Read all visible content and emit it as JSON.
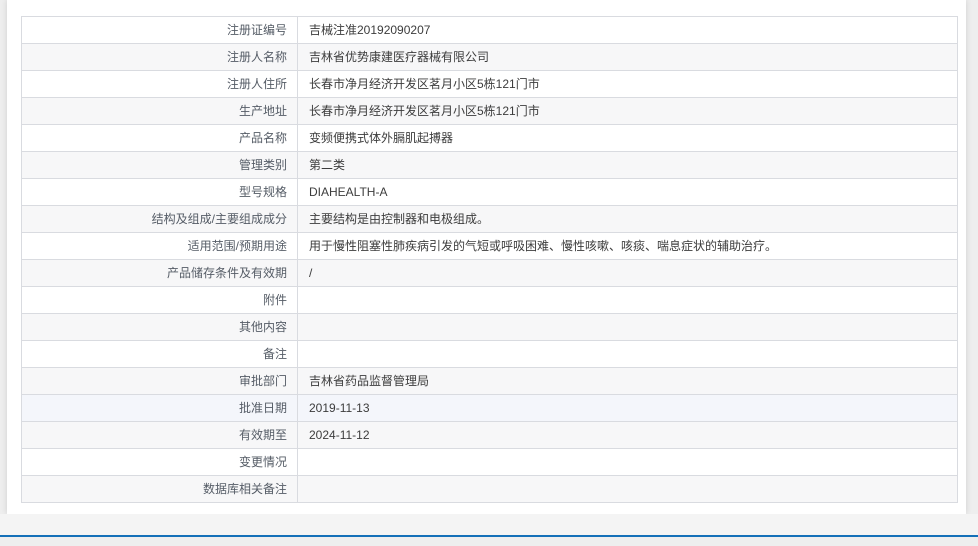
{
  "page": {
    "accent_color": "#1470b8",
    "background_color": "#eeeeee",
    "card_color": "#ffffff",
    "row_alt_color": "#f7f7f8",
    "row_highlight_color": "#f4f6fb"
  },
  "detail_table": {
    "rows": [
      {
        "label": "注册证编号",
        "value": "吉械注准20192090207",
        "style": "row-white"
      },
      {
        "label": "注册人名称",
        "value": "吉林省优势康建医疗器械有限公司",
        "style": "row-gray"
      },
      {
        "label": "注册人住所",
        "value": "长春市净月经济开发区茗月小区5栋121门市",
        "style": "row-white"
      },
      {
        "label": "生产地址",
        "value": "长春市净月经济开发区茗月小区5栋121门市",
        "style": "row-gray"
      },
      {
        "label": "产品名称",
        "value": "变频便携式体外膈肌起搏器",
        "style": "row-white"
      },
      {
        "label": "管理类别",
        "value": "第二类",
        "style": "row-gray"
      },
      {
        "label": "型号规格",
        "value": "DIAHEALTH-A",
        "style": "row-white"
      },
      {
        "label": "结构及组成/主要组成成分",
        "value": "主要结构是由控制器和电极组成。",
        "style": "row-gray"
      },
      {
        "label": "适用范围/预期用途",
        "value": "用于慢性阻塞性肺疾病引发的气短或呼吸困难、慢性咳嗽、咳痰、喘息症状的辅助治疗。",
        "style": "row-white"
      },
      {
        "label": "产品储存条件及有效期",
        "value": "/",
        "style": "row-gray"
      },
      {
        "label": "附件",
        "value": "",
        "style": "row-white"
      },
      {
        "label": "其他内容",
        "value": "",
        "style": "row-gray"
      },
      {
        "label": "备注",
        "value": "",
        "style": "row-white"
      },
      {
        "label": "审批部门",
        "value": "吉林省药品监督管理局",
        "style": "row-gray"
      },
      {
        "label": "批准日期",
        "value": "2019-11-13",
        "style": "row-blue"
      },
      {
        "label": "有效期至",
        "value": "2024-11-12",
        "style": "row-gray"
      },
      {
        "label": "变更情况",
        "value": "",
        "style": "row-white"
      },
      {
        "label": "数据库相关备注",
        "value": "",
        "style": "row-gray"
      }
    ]
  }
}
